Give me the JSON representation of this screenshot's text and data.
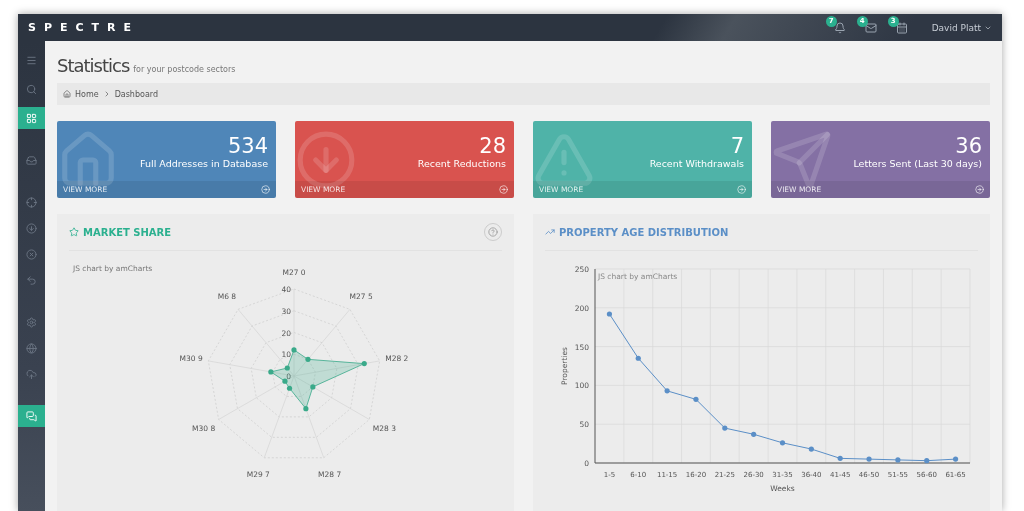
{
  "topbar": {
    "logo": "SPECTRE",
    "notifications": [
      {
        "kind": "bell",
        "count": "7"
      },
      {
        "kind": "mail",
        "count": "4"
      },
      {
        "kind": "calendar",
        "count": "3"
      }
    ],
    "user": "David Platt"
  },
  "sidebar": {
    "items": [
      {
        "kind": "menu",
        "selected": false
      },
      {
        "kind": "search",
        "selected": false
      },
      {
        "kind": "grid",
        "selected": true
      },
      {
        "kind": "inbox",
        "selected": false
      },
      {
        "kind": "target",
        "selected": false
      },
      {
        "kind": "download",
        "selected": false
      },
      {
        "kind": "close",
        "selected": false
      },
      {
        "kind": "reply",
        "selected": false
      },
      {
        "kind": "settings",
        "selected": false
      },
      {
        "kind": "globe",
        "selected": false
      },
      {
        "kind": "upload",
        "selected": false
      },
      {
        "kind": "chat",
        "selected": true
      }
    ]
  },
  "page": {
    "title": "Statistics",
    "subtitle": "for your postcode sectors"
  },
  "breadcrumb": [
    "Home",
    "Dashboard"
  ],
  "stats": [
    {
      "kind": "house",
      "value": "534",
      "label": "Full Addresses in Database",
      "link": "VIEW MORE",
      "color": "#4f86b8"
    },
    {
      "kind": "down",
      "value": "28",
      "label": "Recent Reductions",
      "link": "VIEW MORE",
      "color": "#d9534f"
    },
    {
      "kind": "alert",
      "value": "7",
      "label": "Recent Withdrawals",
      "link": "VIEW MORE",
      "color": "#4fb3a8"
    },
    {
      "kind": "plane",
      "value": "36",
      "label": "Letters Sent (Last 30 days)",
      "link": "VIEW MORE",
      "color": "#8470a4"
    }
  ],
  "panels": [
    {
      "kind": "radar",
      "title": "MARKET SHARE",
      "credit": "JS chart by amCharts",
      "radar": {
        "ticks": [
          "40",
          "30",
          "20",
          "10",
          "0"
        ],
        "axes": [
          "M27 0",
          "M27 5",
          "M28 2",
          "M28 3",
          "M28 7",
          "M29 7",
          "M30 8",
          "M30 9",
          "M6 8"
        ]
      }
    },
    {
      "kind": "line",
      "title": "PROPERTY AGE DISTRIBUTION",
      "credit": "JS chart by amCharts",
      "chart_data": {
        "type": "line",
        "xlabel": "Weeks",
        "ylabel": "Properties",
        "grid": true,
        "categories": [
          "1-5",
          "6-10",
          "11-15",
          "16-20",
          "21-25",
          "26-30",
          "31-35",
          "36-40",
          "41-45",
          "46-50",
          "51-55",
          "56-60",
          "61-65"
        ],
        "series": [
          {
            "color": "#5b8fc7",
            "values": [
              192,
              135,
              93,
              82,
              45,
              37,
              26,
              18,
              6,
              5,
              4,
              3,
              5
            ]
          }
        ],
        "ylim": [
          0,
          250
        ],
        "yticks": [
          0,
          50,
          100,
          150,
          200,
          250
        ]
      }
    }
  ]
}
